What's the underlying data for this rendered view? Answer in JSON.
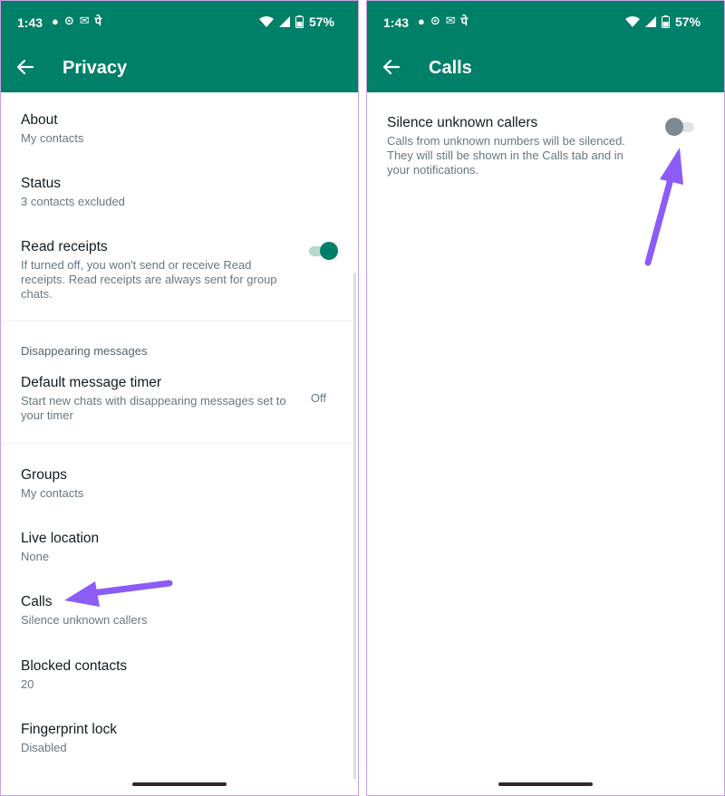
{
  "status_bar": {
    "time": "1:43",
    "notif_glyphs": [
      "●",
      "⊙",
      "✉",
      "पे"
    ],
    "battery": "57%"
  },
  "left_screen": {
    "title": "Privacy",
    "items": [
      {
        "title": "About",
        "subtitle": "My contacts"
      },
      {
        "title": "Status",
        "subtitle": "3 contacts excluded"
      },
      {
        "title": "Read receipts",
        "subtitle": "If turned off, you won't send or receive Read receipts. Read receipts are always sent for group chats.",
        "toggle": "on"
      }
    ],
    "section_header": "Disappearing messages",
    "timer": {
      "title": "Default message timer",
      "subtitle": "Start new chats with disappearing messages set to your timer",
      "value": "Off"
    },
    "items2": [
      {
        "title": "Groups",
        "subtitle": "My contacts"
      },
      {
        "title": "Live location",
        "subtitle": "None"
      },
      {
        "title": "Calls",
        "subtitle": "Silence unknown callers"
      },
      {
        "title": "Blocked contacts",
        "subtitle": "20"
      },
      {
        "title": "Fingerprint lock",
        "subtitle": "Disabled"
      }
    ]
  },
  "right_screen": {
    "title": "Calls",
    "silence": {
      "title": "Silence unknown callers",
      "subtitle": "Calls from unknown numbers will be silenced. They will still be shown in the Calls tab and in your notifications.",
      "toggle": "off"
    }
  },
  "colors": {
    "header": "#008069",
    "arrow": "#8b5cf6"
  }
}
